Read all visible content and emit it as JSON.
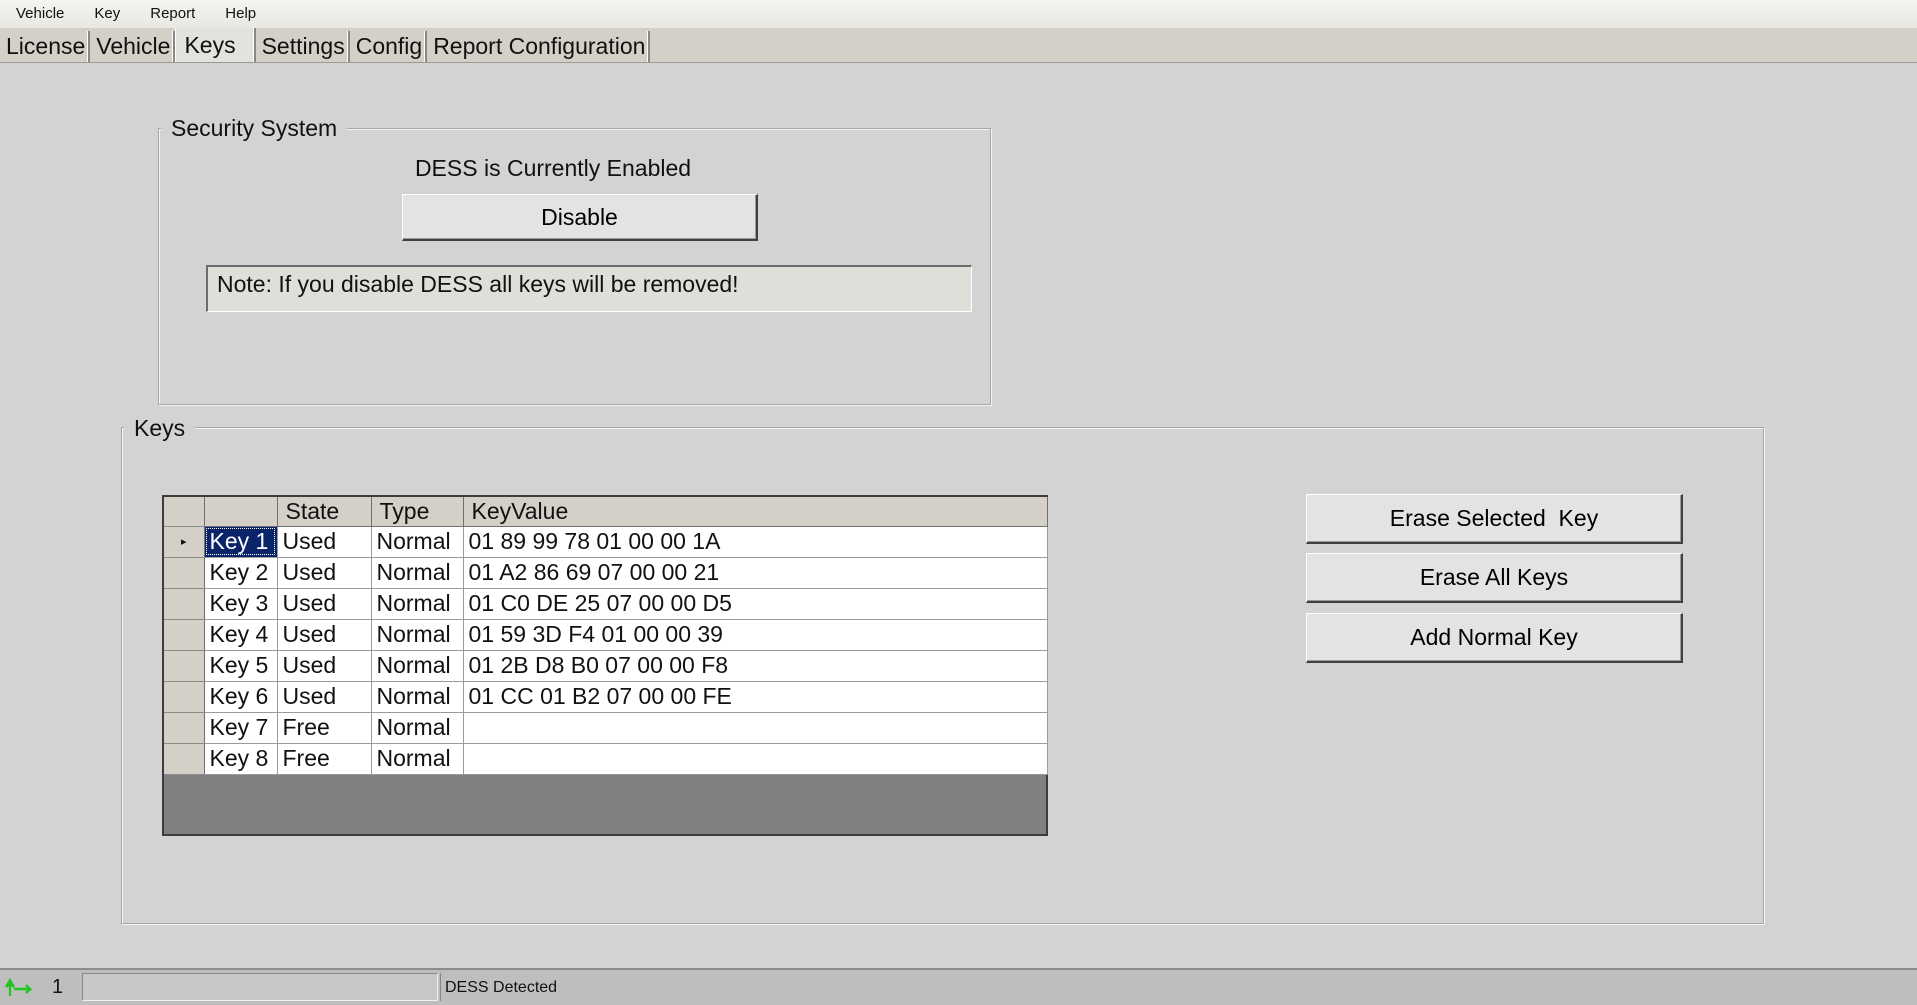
{
  "menu": [
    "Vehicle",
    "Key",
    "Report",
    "Help"
  ],
  "tabs": [
    "License",
    "Vehicle",
    "Keys",
    "Settings",
    "Config",
    "Report Configuration"
  ],
  "active_tab": "Keys",
  "security": {
    "legend": "Security System",
    "status": "DESS is Currently Enabled",
    "disable_label": "Disable",
    "note": "Note: If you disable DESS all keys will be removed!"
  },
  "keys": {
    "legend": "Keys",
    "columns": [
      "State",
      "Type",
      "KeyValue"
    ],
    "selected_row": 0,
    "rows": [
      {
        "name": "Key 1",
        "state": "Used",
        "type": "Normal",
        "value": "01 89 99 78 01 00 00 1A"
      },
      {
        "name": "Key 2",
        "state": "Used",
        "type": "Normal",
        "value": "01 A2 86 69 07 00 00 21"
      },
      {
        "name": "Key 3",
        "state": "Used",
        "type": "Normal",
        "value": "01 C0 DE 25 07 00 00 D5"
      },
      {
        "name": "Key 4",
        "state": "Used",
        "type": "Normal",
        "value": "01 59 3D F4 01 00 00 39"
      },
      {
        "name": "Key 5",
        "state": "Used",
        "type": "Normal",
        "value": "01 2B D8 B0 07 00 00 F8"
      },
      {
        "name": "Key 6",
        "state": "Used",
        "type": "Normal",
        "value": "01 CC 01 B2 07 00 00 FE"
      },
      {
        "name": "Key 7",
        "state": "Free",
        "type": "Normal",
        "value": ""
      },
      {
        "name": "Key 8",
        "state": "Free",
        "type": "Normal",
        "value": ""
      }
    ],
    "buttons": {
      "erase_selected": "Erase Selected  Key",
      "erase_all": "Erase All Keys",
      "add_normal": "Add Normal Key"
    }
  },
  "statusbar": {
    "connection_icon": "connection-arrows-icon",
    "count": "1",
    "progress": 0,
    "message": "DESS Detected"
  },
  "colors": {
    "selection": "#0a246a",
    "connection_icon": "#22c422"
  }
}
